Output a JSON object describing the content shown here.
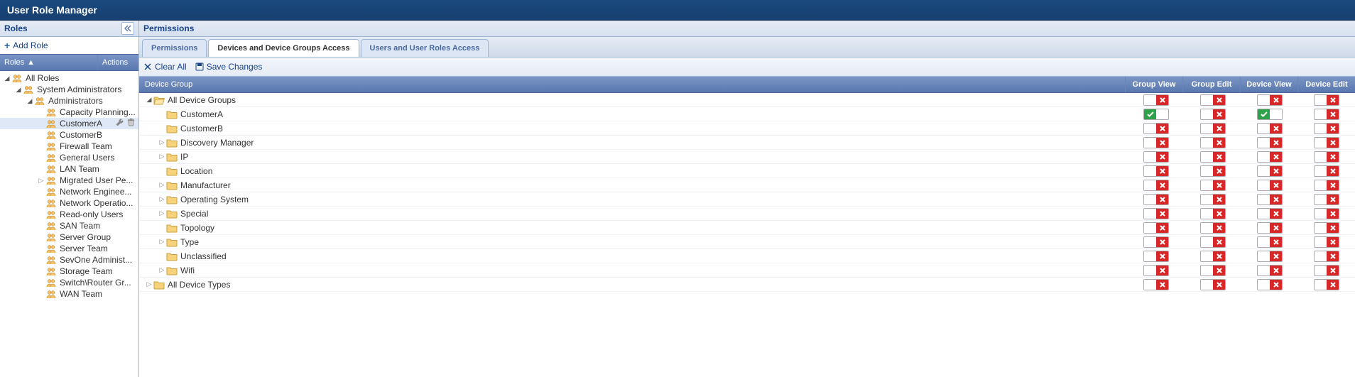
{
  "title": "User Role Manager",
  "sidebar": {
    "header": "Roles",
    "add_role": "Add Role",
    "col_roles": "Roles",
    "col_actions": "Actions",
    "tree": [
      {
        "label": "All Roles",
        "depth": 0,
        "arrow": "down",
        "selected": false,
        "actions": false
      },
      {
        "label": "System Administrators",
        "depth": 1,
        "arrow": "down",
        "selected": false,
        "actions": false
      },
      {
        "label": "Administrators",
        "depth": 2,
        "arrow": "down",
        "selected": false,
        "actions": false
      },
      {
        "label": "Capacity Planning...",
        "depth": 3,
        "arrow": "",
        "selected": false,
        "actions": false
      },
      {
        "label": "CustomerA",
        "depth": 3,
        "arrow": "",
        "selected": true,
        "actions": true
      },
      {
        "label": "CustomerB",
        "depth": 3,
        "arrow": "",
        "selected": false,
        "actions": false
      },
      {
        "label": "Firewall Team",
        "depth": 3,
        "arrow": "",
        "selected": false,
        "actions": false
      },
      {
        "label": "General Users",
        "depth": 3,
        "arrow": "",
        "selected": false,
        "actions": false
      },
      {
        "label": "LAN Team",
        "depth": 3,
        "arrow": "",
        "selected": false,
        "actions": false
      },
      {
        "label": "Migrated User Pe...",
        "depth": 3,
        "arrow": "right",
        "selected": false,
        "actions": false
      },
      {
        "label": "Network Enginee...",
        "depth": 3,
        "arrow": "",
        "selected": false,
        "actions": false
      },
      {
        "label": "Network Operatio...",
        "depth": 3,
        "arrow": "",
        "selected": false,
        "actions": false
      },
      {
        "label": "Read-only Users",
        "depth": 3,
        "arrow": "",
        "selected": false,
        "actions": false
      },
      {
        "label": "SAN Team",
        "depth": 3,
        "arrow": "",
        "selected": false,
        "actions": false
      },
      {
        "label": "Server Group",
        "depth": 3,
        "arrow": "",
        "selected": false,
        "actions": false
      },
      {
        "label": "Server Team",
        "depth": 3,
        "arrow": "",
        "selected": false,
        "actions": false
      },
      {
        "label": "SevOne Administ...",
        "depth": 3,
        "arrow": "",
        "selected": false,
        "actions": false
      },
      {
        "label": "Storage Team",
        "depth": 3,
        "arrow": "",
        "selected": false,
        "actions": false
      },
      {
        "label": "Switch\\Router Gr...",
        "depth": 3,
        "arrow": "",
        "selected": false,
        "actions": false
      },
      {
        "label": "WAN Team",
        "depth": 3,
        "arrow": "",
        "selected": false,
        "actions": false
      }
    ]
  },
  "main": {
    "panel_title": "Permissions",
    "tabs": [
      {
        "label": "Permissions",
        "active": false
      },
      {
        "label": "Devices and Device Groups Access",
        "active": true
      },
      {
        "label": "Users and User Roles Access",
        "active": false
      }
    ],
    "toolbar": {
      "clear_all": "Clear All",
      "save_changes": "Save Changes"
    },
    "grid": {
      "col_name": "Device Group",
      "cols": [
        "Group View",
        "Group Edit",
        "Device View",
        "Device Edit"
      ],
      "rows": [
        {
          "label": "All Device Groups",
          "depth": 0,
          "arrow": "down",
          "open": true,
          "perm": [
            "no",
            "no",
            "no",
            "no"
          ]
        },
        {
          "label": "CustomerA",
          "depth": 1,
          "arrow": "",
          "perm": [
            "yes",
            "no",
            "yes",
            "no"
          ]
        },
        {
          "label": "CustomerB",
          "depth": 1,
          "arrow": "",
          "perm": [
            "no",
            "no",
            "no",
            "no"
          ]
        },
        {
          "label": "Discovery Manager",
          "depth": 1,
          "arrow": "right",
          "perm": [
            "no",
            "no",
            "no",
            "no"
          ]
        },
        {
          "label": "IP",
          "depth": 1,
          "arrow": "right",
          "perm": [
            "no",
            "no",
            "no",
            "no"
          ]
        },
        {
          "label": "Location",
          "depth": 1,
          "arrow": "",
          "perm": [
            "no",
            "no",
            "no",
            "no"
          ]
        },
        {
          "label": "Manufacturer",
          "depth": 1,
          "arrow": "right",
          "perm": [
            "no",
            "no",
            "no",
            "no"
          ]
        },
        {
          "label": "Operating System",
          "depth": 1,
          "arrow": "right",
          "perm": [
            "no",
            "no",
            "no",
            "no"
          ]
        },
        {
          "label": "Special",
          "depth": 1,
          "arrow": "right",
          "perm": [
            "no",
            "no",
            "no",
            "no"
          ]
        },
        {
          "label": "Topology",
          "depth": 1,
          "arrow": "",
          "perm": [
            "no",
            "no",
            "no",
            "no"
          ]
        },
        {
          "label": "Type",
          "depth": 1,
          "arrow": "right",
          "perm": [
            "no",
            "no",
            "no",
            "no"
          ]
        },
        {
          "label": "Unclassified",
          "depth": 1,
          "arrow": "",
          "perm": [
            "no",
            "no",
            "no",
            "no"
          ]
        },
        {
          "label": "Wifi",
          "depth": 1,
          "arrow": "right",
          "perm": [
            "no",
            "no",
            "no",
            "no"
          ]
        },
        {
          "label": "All Device Types",
          "depth": 0,
          "arrow": "right",
          "perm": [
            "no",
            "no",
            "no",
            "no"
          ]
        }
      ]
    }
  }
}
